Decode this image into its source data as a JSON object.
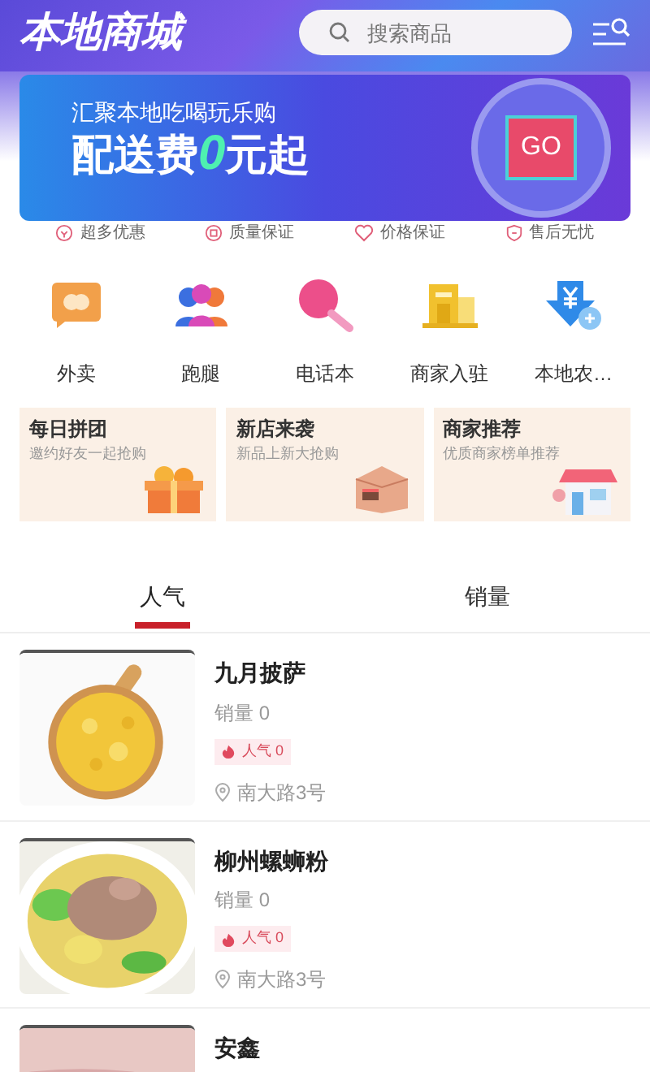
{
  "header": {
    "title": "本地商城",
    "search": {
      "placeholder": "搜索商品"
    }
  },
  "banner": {
    "subtitle": "汇聚本地吃喝玩乐购",
    "headline_prefix": "配送费",
    "headline_number": "0",
    "headline_suffix": "元起",
    "go": "GO"
  },
  "guarantees": [
    {
      "kind": "coupon",
      "label": "超多优惠"
    },
    {
      "kind": "quality",
      "label": "质量保证"
    },
    {
      "kind": "heart",
      "label": "价格保证"
    },
    {
      "kind": "shield",
      "label": "售后无忧"
    }
  ],
  "categories": [
    {
      "kind": "takeout",
      "label": "外卖"
    },
    {
      "kind": "errand",
      "label": "跑腿"
    },
    {
      "kind": "phonebook",
      "label": "电话本"
    },
    {
      "kind": "merchant",
      "label": "商家入驻"
    },
    {
      "kind": "farm",
      "label": "本地农…"
    }
  ],
  "promos": [
    {
      "kind": "gift",
      "title": "每日拼团",
      "subtitle": "邀约好友一起抢购"
    },
    {
      "kind": "box",
      "title": "新店来袭",
      "subtitle": "新品上新大抢购"
    },
    {
      "kind": "shop",
      "title": "商家推荐",
      "subtitle": "优质商家榜单推荐"
    }
  ],
  "tabs": [
    {
      "label": "人气",
      "selected": true
    },
    {
      "label": "销量",
      "selected": false
    }
  ],
  "products": [
    {
      "kind": "pizza",
      "name": "九月披萨",
      "sales": "销量 0",
      "popularity": "人气 0",
      "address": "南大路3号"
    },
    {
      "kind": "noodles",
      "name": "柳州螺蛳粉",
      "sales": "销量 0",
      "popularity": "人气 0",
      "address": "南大路3号"
    },
    {
      "kind": "dish",
      "name": "安鑫"
    }
  ]
}
